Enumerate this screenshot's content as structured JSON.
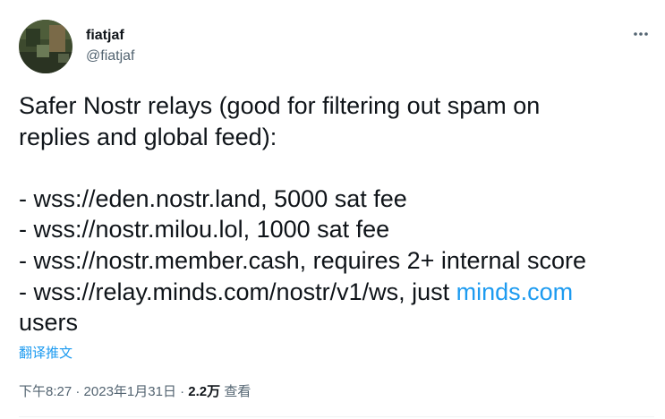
{
  "author": {
    "display_name": "fiatjaf",
    "handle": "@fiatjaf"
  },
  "tweet": {
    "line1": "Safer Nostr relays (good for filtering out spam on",
    "line2": "replies and global feed):",
    "relay1": "- wss://eden.nostr.land, 5000 sat fee",
    "relay2": "- wss://nostr.milou.lol, 1000 sat fee",
    "relay3": "- wss://nostr.member.cash, requires 2+ internal score",
    "relay4_text": "- wss://relay.minds.com/nostr/v1/ws, just ",
    "relay4_link": "minds.com",
    "line_end": "users"
  },
  "translate_label": "翻译推文",
  "meta": {
    "time": "下午8:27",
    "sep1": " · ",
    "date": "2023年1月31日",
    "sep2": " · ",
    "views_count": "2.2万",
    "views_label": " 查看"
  },
  "colors": {
    "link": "#1d9bf0",
    "secondary_text": "#536471",
    "primary_text": "#0f1419"
  },
  "icons": {
    "more": "more-horizontal-icon",
    "avatar": "profile-photo"
  }
}
